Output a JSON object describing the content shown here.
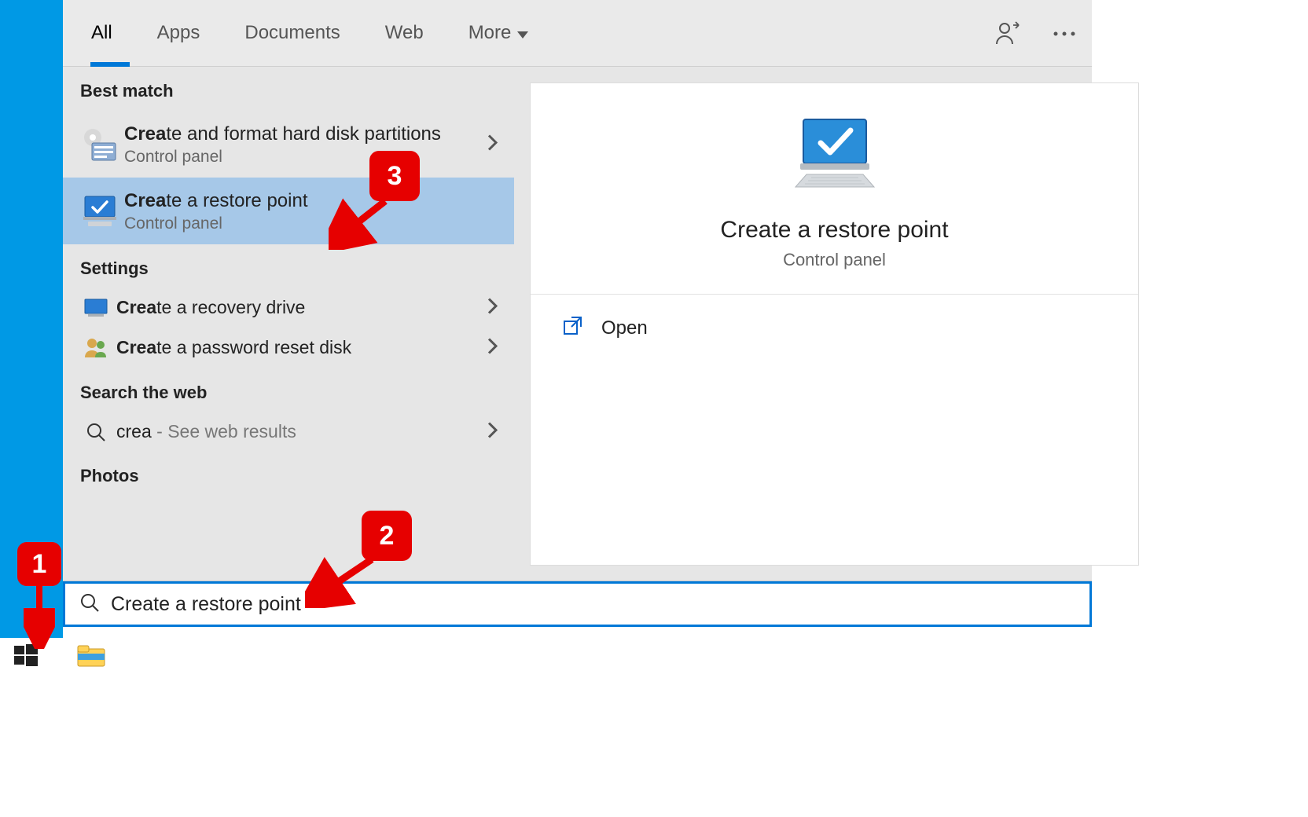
{
  "tabs": {
    "all": "All",
    "apps": "Apps",
    "documents": "Documents",
    "web": "Web",
    "more": "More"
  },
  "sections": {
    "best_match": "Best match",
    "settings": "Settings",
    "search_web": "Search the web",
    "photos": "Photos"
  },
  "results": {
    "partitions": {
      "title_bold": "Crea",
      "title_rest": "te and format hard disk partitions",
      "sub": "Control panel"
    },
    "restore": {
      "title_bold": "Crea",
      "title_rest": "te a restore point",
      "sub": "Control panel"
    },
    "recovery": {
      "title_bold": "Crea",
      "title_rest": "te a recovery drive"
    },
    "password_disk": {
      "title_bold": "Crea",
      "title_rest": "te a password reset disk"
    },
    "web": {
      "term": "crea",
      "suffix": " - See web results"
    }
  },
  "preview": {
    "title": "Create a restore point",
    "sub": "Control panel",
    "open_label": "Open"
  },
  "search": {
    "value": "Create a restore point"
  },
  "callouts": {
    "one": "1",
    "two": "2",
    "three": "3"
  }
}
